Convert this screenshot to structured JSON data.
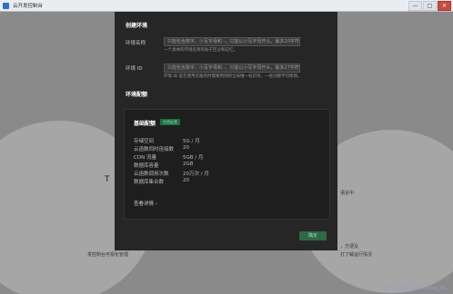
{
  "window": {
    "title": "云开发控制台",
    "minimize": "—",
    "maximize": "□",
    "close": "✕"
  },
  "background": {
    "left_heading": "T",
    "left_bottom_text": "发控制台可视化管理",
    "right_text_1": "语言中",
    "right_bottom_text_1": "，方便及",
    "right_bottom_text_2": "打了解运行情况"
  },
  "modal": {
    "section_create": "创建环境",
    "env_name_label": "环境名称",
    "env_name_placeholder": "只能包含数字、小写字母和 -，只能以小写字母开头，最多20字符",
    "env_name_hint": "一个具体的环境名称有助于区分和记忆。",
    "env_id_label": "环境 ID",
    "env_id_placeholder": "只能包含数字、小写字母和 -，只能以小写字母开头，最多27字符",
    "env_id_hint": "环境 ID 是在使用云服务时需要用到的全局唯一标识符，一经创建不可修改。",
    "section_config": "环境配额",
    "card": {
      "title": "基础配额",
      "badge": "免费配置",
      "rows": [
        {
          "label": "存储空间",
          "value": "5G / 月"
        },
        {
          "label": "云函数同时连接数",
          "value": "20"
        },
        {
          "label": "CDN 流量",
          "value": "5GB / 月"
        },
        {
          "label": "数据库容量",
          "value": "2GB"
        },
        {
          "label": "云函数调用次数",
          "value": "20万次 / 月"
        },
        {
          "label": "数据库集合数",
          "value": "20"
        }
      ],
      "details_link": "查看详情 ›"
    },
    "confirm_button": "确定"
  },
  "watermark": "https://blog.csdn.net/qq_43..."
}
